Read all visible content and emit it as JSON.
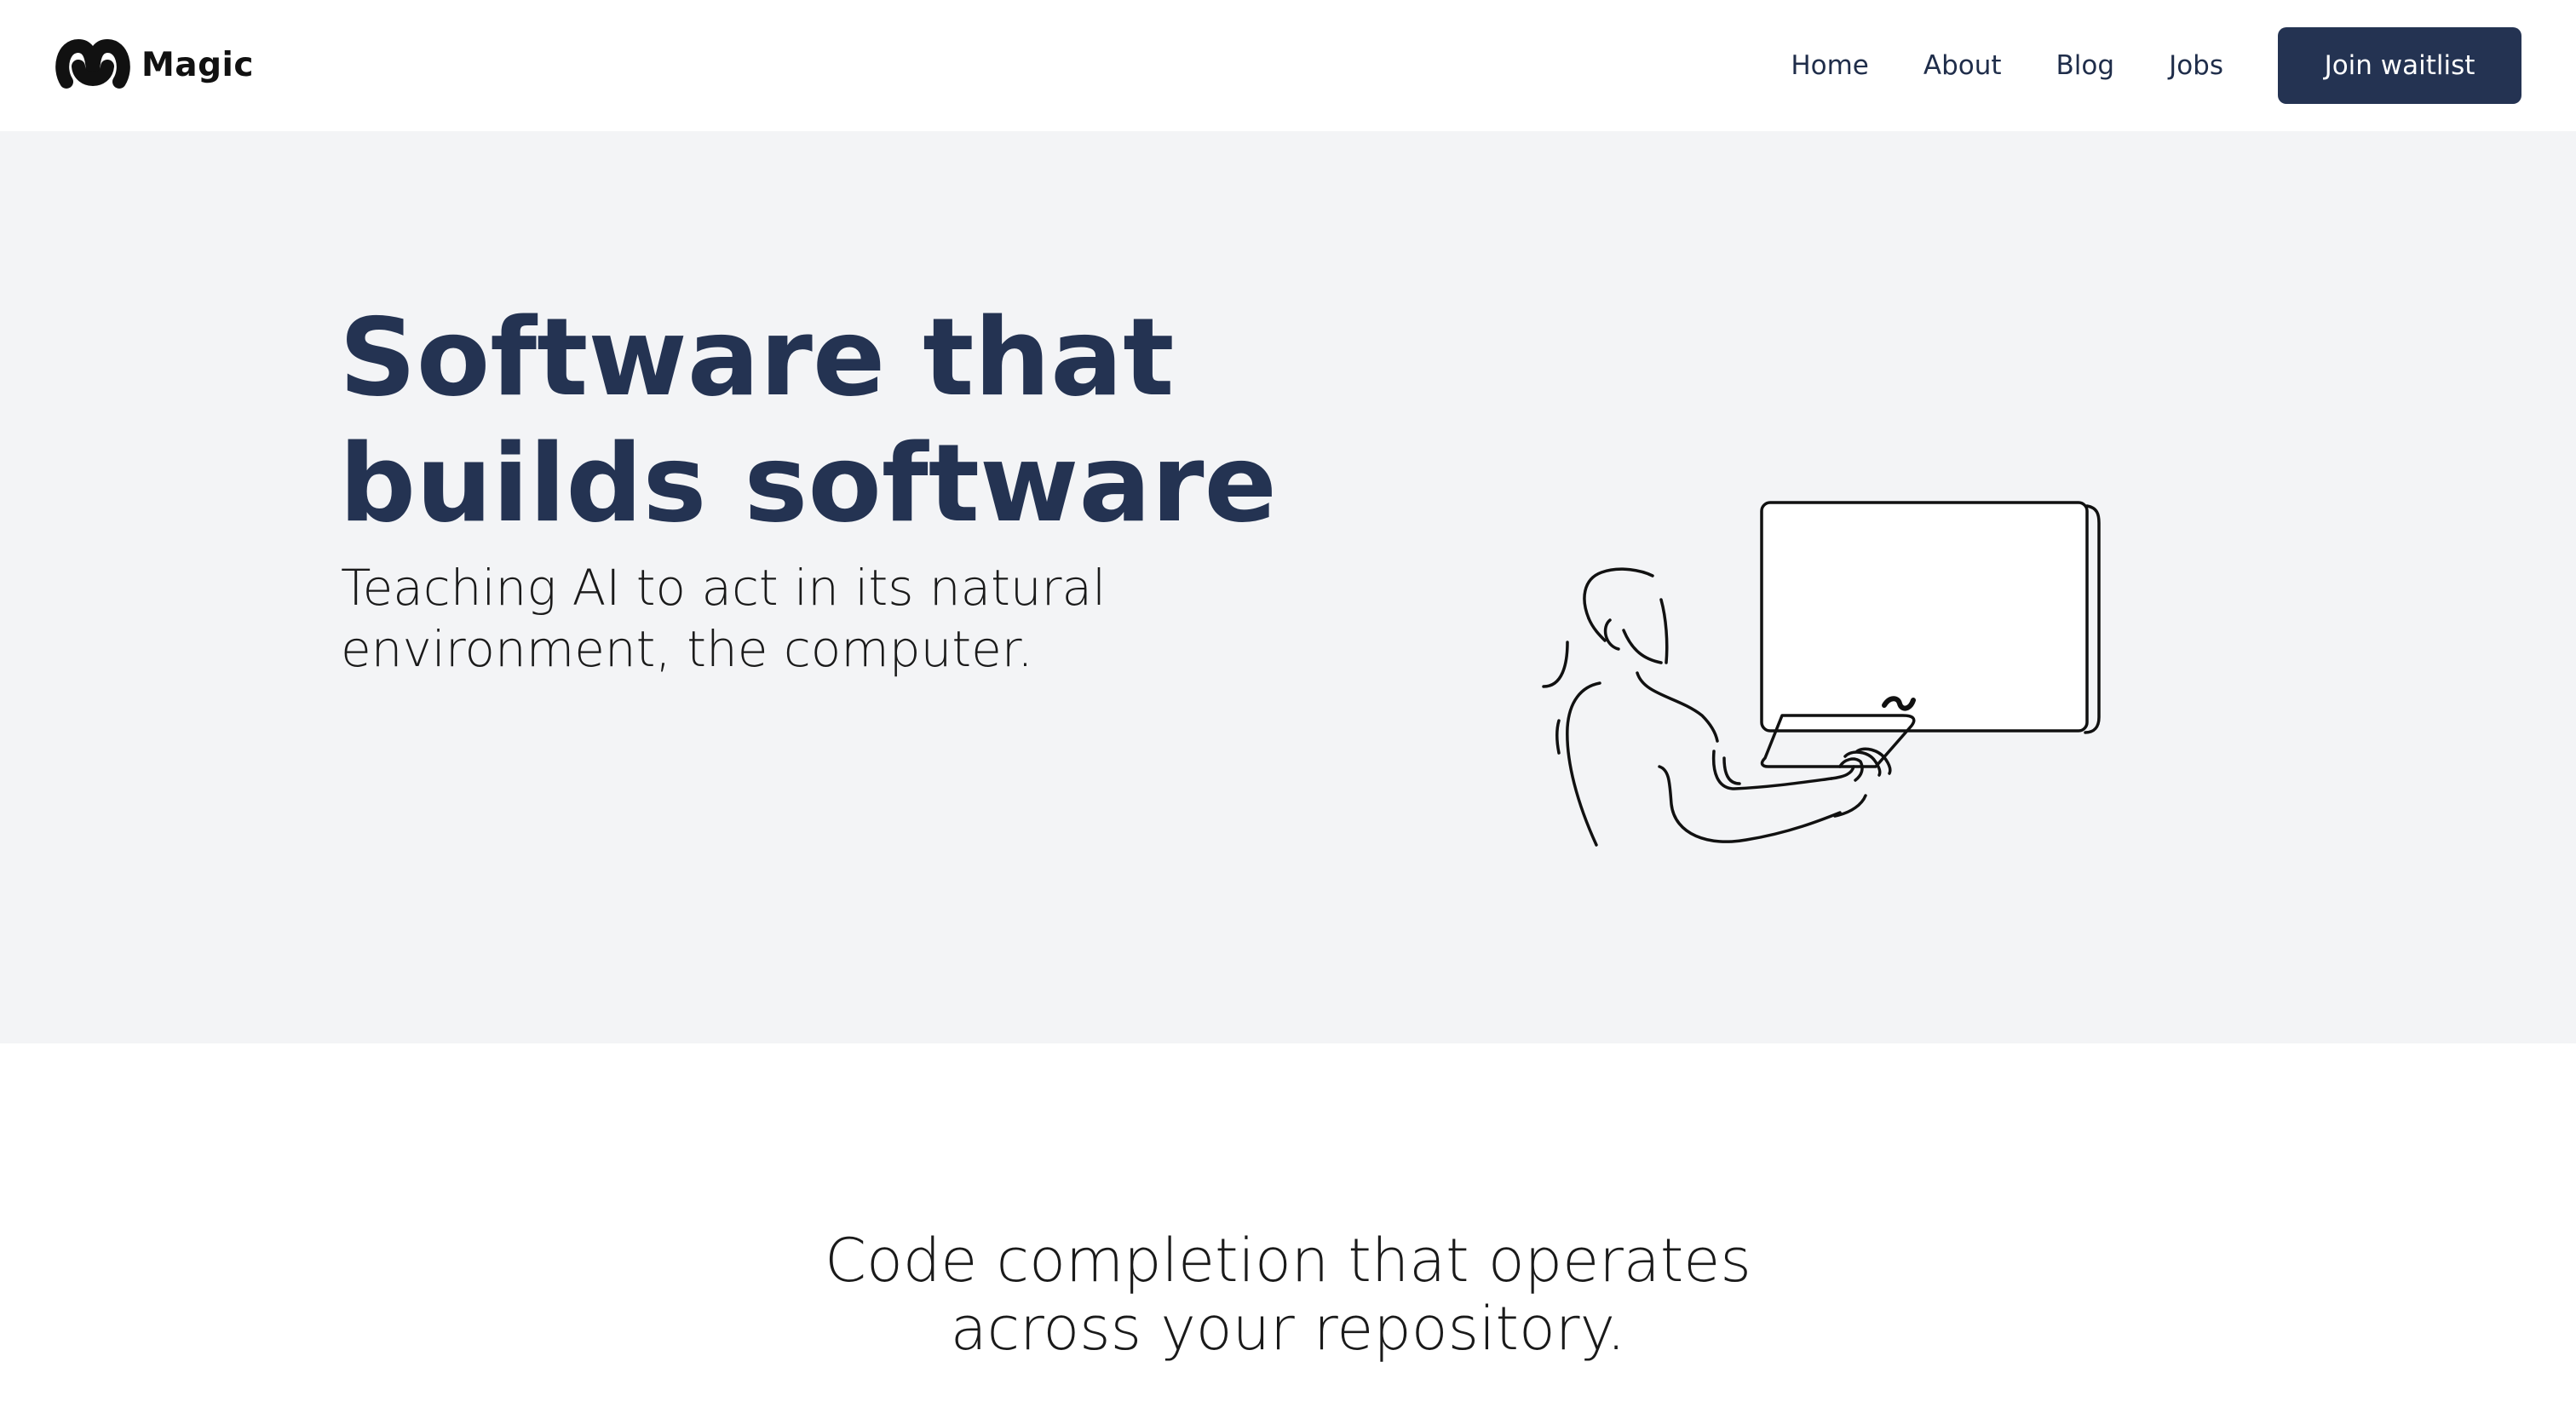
{
  "brand": {
    "name": "Magic",
    "logo_icon": "magic-wave-logo-icon"
  },
  "nav": {
    "items": [
      {
        "label": "Home"
      },
      {
        "label": "About"
      },
      {
        "label": "Blog"
      },
      {
        "label": "Jobs"
      }
    ],
    "cta_label": "Join waitlist"
  },
  "hero": {
    "title_line1": "Software that",
    "title_line2": "builds software",
    "subtitle_line1": "Teaching AI to act in its natural",
    "subtitle_line2": "environment, the computer.",
    "illustration": "person-using-computer-illustration"
  },
  "section": {
    "heading_line1": "Code completion that operates",
    "heading_line2": "across your repository."
  },
  "colors": {
    "primary": "#243352",
    "hero_background": "#f3f4f6",
    "page_background": "#ffffff",
    "text_dark": "#1a1a1a"
  }
}
